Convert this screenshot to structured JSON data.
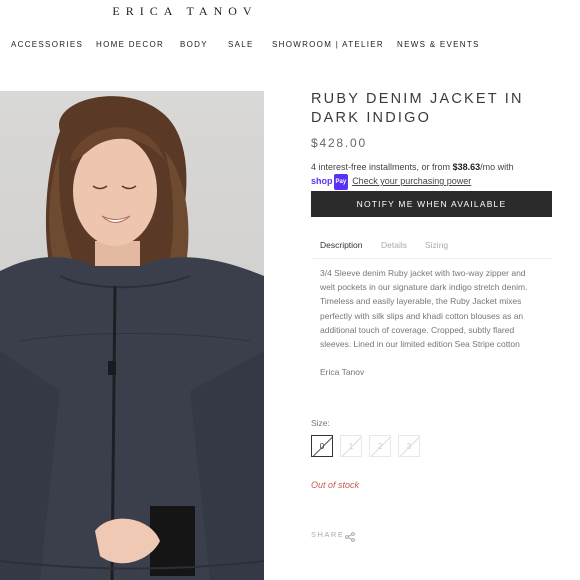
{
  "brand": {
    "logo": "ERICA TANOV"
  },
  "nav": {
    "items": [
      {
        "label": "ACCESSORIES"
      },
      {
        "label": "HOME DECOR"
      },
      {
        "label": "BODY"
      },
      {
        "label": "SALE"
      },
      {
        "label": "SHOWROOM | ATELIER"
      },
      {
        "label": "NEWS & EVENTS"
      }
    ]
  },
  "product": {
    "title": "RUBY DENIM JACKET IN DARK INDIGO",
    "price": "$428.00",
    "installments": {
      "prefix": "4 interest-free installments, or from",
      "amount": "$38.63",
      "suffix": "/mo with",
      "shop_label": "shop",
      "pay_label": "Pay",
      "link": "Check your purchasing power"
    },
    "notify_label": "NOTIFY ME WHEN AVAILABLE",
    "tabs": [
      {
        "label": "Description",
        "active": true
      },
      {
        "label": "Details"
      },
      {
        "label": "Sizing"
      }
    ],
    "description": "3/4 Sleeve denim Ruby jacket with two-way zipper and welt pockets in our signature dark indigo stretch denim. Timeless and easily layerable, the Ruby Jacket mixes perfectly with silk slips and khadi cotton blouses as an additional touch of coverage. Cropped, subtly flared sleeves. Lined in our limited edition Sea Stripe cotton",
    "maker": "Erica Tanov",
    "size_label": "Size:",
    "sizes": [
      "0",
      "1",
      "2",
      "3"
    ],
    "selected_size": "0",
    "stock_status": "Out of stock",
    "share_label": "SHARE"
  },
  "colors": {
    "accent_dark": "#2b2b2b",
    "out_of_stock": "#c25a55",
    "shop_pay": "#5a31f4",
    "denim": "#3b3f4c"
  },
  "icons": {
    "share": "share-icon"
  }
}
